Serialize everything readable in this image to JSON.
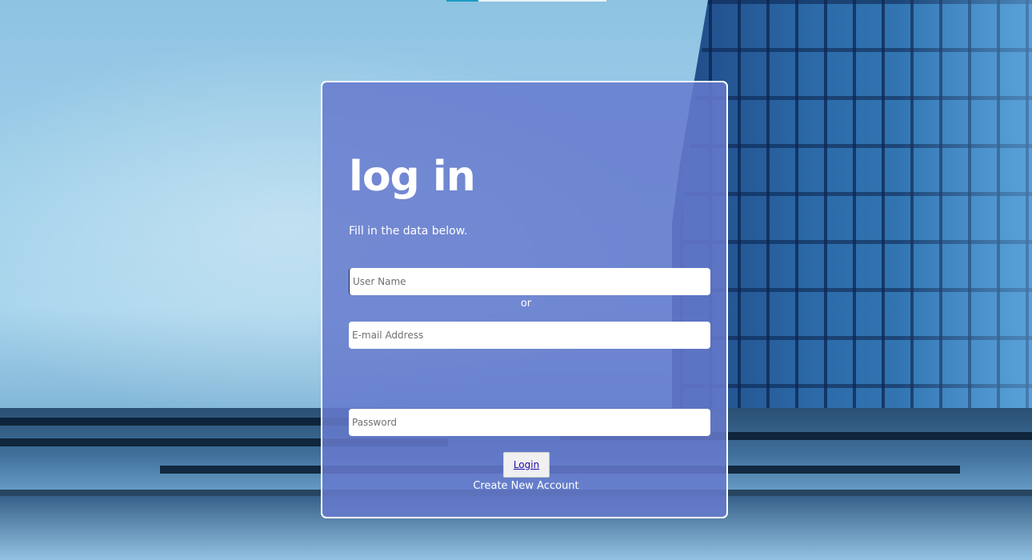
{
  "page": {
    "accent_color": "#667acd",
    "card_border_color": "#ffffff"
  },
  "login": {
    "title": "log in",
    "subtitle": "Fill in the data below.",
    "username_placeholder": "User Name",
    "separator": "or",
    "email_placeholder": "E-mail Address",
    "password_placeholder": "Password",
    "submit_label": "Login",
    "create_account_label": "Create New Account"
  }
}
